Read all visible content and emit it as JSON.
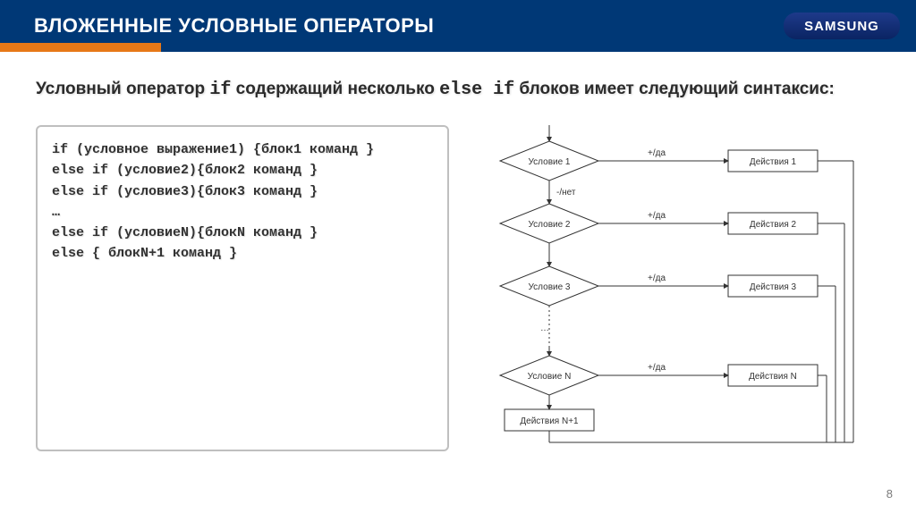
{
  "header": {
    "title": "ВЛОЖЕННЫЕ УСЛОВНЫЕ ОПЕРАТОРЫ",
    "logo": "SAMSUNG"
  },
  "subtitle": {
    "part1": "Условный оператор ",
    "code1": "if",
    "part2": " содержащий несколько ",
    "code2": "else if",
    "part3": " блоков имеет следующий синтаксис:"
  },
  "code": {
    "l1": "if (условное выражение1) {блок1 команд }",
    "l2": "else if (условие2){блок2 команд }",
    "l3": "else if (условие3){блок3 команд }",
    "l4": "…",
    "l5": "else if (условиеN){блокN команд }",
    "l6": "else { блокN+1 команд }"
  },
  "flow": {
    "cond1": "Условие 1",
    "cond2": "Условие 2",
    "cond3": "Условие 3",
    "condN": "Условие N",
    "act1": "Действия 1",
    "act2": "Действия 2",
    "act3": "Действия 3",
    "actN": "Действия N",
    "actN1": "Действия N+1",
    "yes": "+/да",
    "no": "-/нет"
  },
  "page": "8"
}
